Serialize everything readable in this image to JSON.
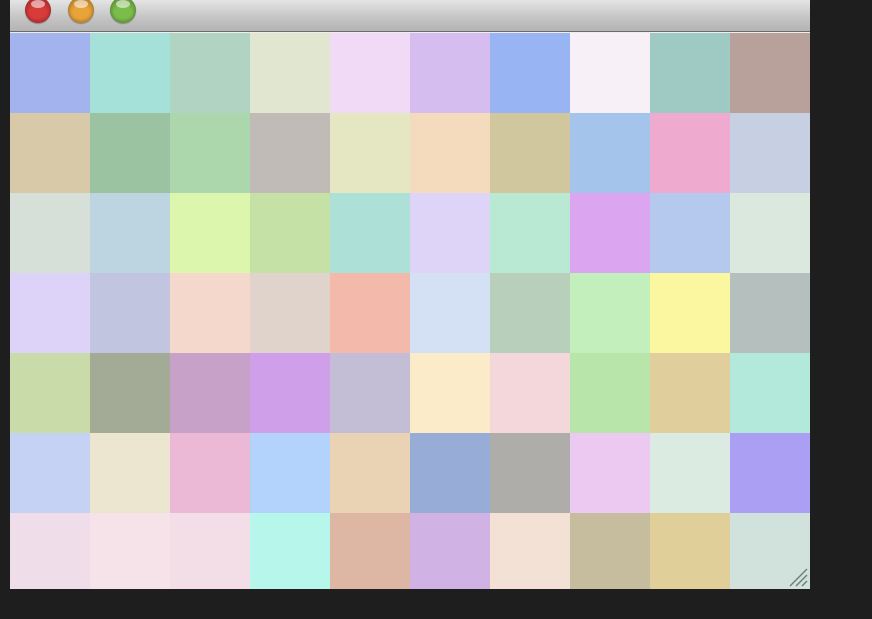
{
  "window": {
    "controls": [
      {
        "name": "close-button",
        "color": "#d93a3a"
      },
      {
        "name": "minimize-button",
        "color": "#e8a43a"
      },
      {
        "name": "zoom-button",
        "color": "#7bbd4a"
      }
    ]
  },
  "palette": {
    "rows": [
      [
        "#a3b3ee",
        "#a5e0d9",
        "#b1d3c1",
        "#e1e6d0",
        "#f1daf6",
        "#d6bdf0",
        "#98b4f3",
        "#f7f0f7",
        "#9ecac3",
        "#b8a19a"
      ],
      [
        "#d8caa8",
        "#9bc3a2",
        "#acd7ad",
        "#c0bbb7",
        "#e4e7c1",
        "#f4dbbd",
        "#d1c79f",
        "#a4c4ec",
        "#efaacf",
        "#c7d0e2"
      ],
      [
        "#d7dfd9",
        "#bdd4e1",
        "#ddf6ad",
        "#c6e1a6",
        "#ade1d7",
        "#ded4f8",
        "#b9e9d3",
        "#dca5ef",
        "#b5c9ef",
        "#dbe8de"
      ],
      [
        "#ddd3f9",
        "#c1c5e0",
        "#f4d8cc",
        "#e0d3cb",
        "#f3b9aa",
        "#d4e1f4",
        "#b8d0bb",
        "#c3efbc",
        "#fbf6a0",
        "#b5bfbe"
      ],
      [
        "#c9dba9",
        "#a3ab97",
        "#c7a1c7",
        "#d09fe9",
        "#c3bed6",
        "#fcebc9",
        "#f3d7da",
        "#b7e5aa",
        "#e1ce9d",
        "#b2e9da"
      ],
      [
        "#c5d2f3",
        "#ece5cf",
        "#ebb9d6",
        "#b3d2fc",
        "#e9d3b4",
        "#97acd6",
        "#aeadaa",
        "#ecc9f1",
        "#dbebe1",
        "#ab9ff3"
      ],
      [
        "#efdee9",
        "#f6e3e9",
        "#f3dde7",
        "#b7f6ea",
        "#ddb7a4",
        "#d1b2e4",
        "#f3e1d6",
        "#c6bd9e",
        "#e0cf98",
        "#d0e2db"
      ]
    ]
  }
}
